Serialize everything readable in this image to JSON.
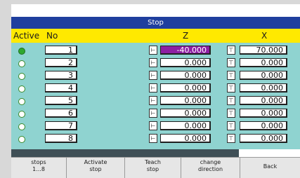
{
  "window": {
    "title": "Stop"
  },
  "header": {
    "active": "Active",
    "no": "No",
    "z": "Z",
    "x": "X"
  },
  "rows": [
    {
      "active": true,
      "no": "1",
      "z": "-40.000",
      "z_selected": true,
      "x": "70.000"
    },
    {
      "active": false,
      "no": "2",
      "z": "0.000",
      "z_selected": false,
      "x": "0.000"
    },
    {
      "active": false,
      "no": "3",
      "z": "0.000",
      "z_selected": false,
      "x": "0.000"
    },
    {
      "active": false,
      "no": "4",
      "z": "0.000",
      "z_selected": false,
      "x": "0.000"
    },
    {
      "active": false,
      "no": "5",
      "z": "0.000",
      "z_selected": false,
      "x": "0.000"
    },
    {
      "active": false,
      "no": "6",
      "z": "0.000",
      "z_selected": false,
      "x": "0.000"
    },
    {
      "active": false,
      "no": "7",
      "z": "0.000",
      "z_selected": false,
      "x": "0.000"
    },
    {
      "active": false,
      "no": "8",
      "z": "0.000",
      "z_selected": false,
      "x": "0.000"
    }
  ],
  "icons": {
    "z_direction": "arrow-left-bar-icon",
    "x_direction": "arrow-up-bar-icon"
  },
  "softkeys": [
    {
      "label": "stops\n1...8"
    },
    {
      "label": "Activate\nstop"
    },
    {
      "label": "Teach\nstop"
    },
    {
      "label": "change\ndirection"
    },
    {
      "label": "Back"
    }
  ],
  "colors": {
    "title_bar": "#1f3f9e",
    "header": "#ffe900",
    "background": "#8fd3d0",
    "selected_value": "#8e1fa3",
    "active_dot": "#2fa82f"
  }
}
